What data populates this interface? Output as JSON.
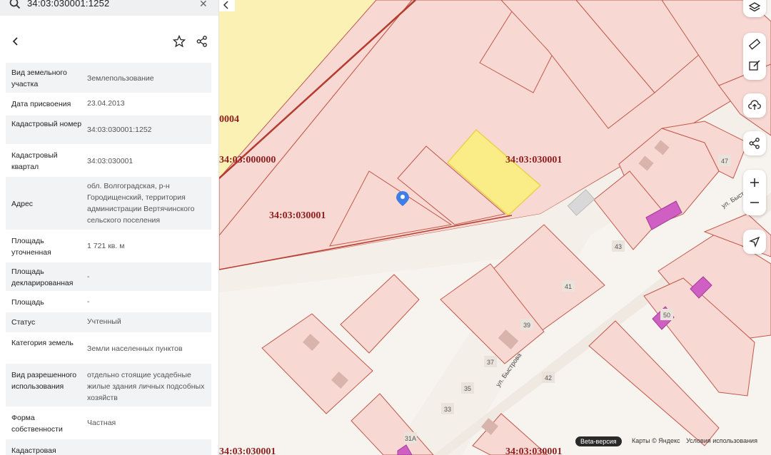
{
  "search": {
    "value": "34:03:030001:1252"
  },
  "icons": {
    "search": "search-icon",
    "clear": "close-icon",
    "back": "chevron-left-icon",
    "favorite": "star-icon",
    "share": "share-icon",
    "layers": "layers-icon",
    "ruler": "ruler-icon",
    "edit": "edit-icon",
    "upload": "upload-icon",
    "map_share": "share-icon",
    "zoom_in": "plus-icon",
    "zoom_out": "minus-icon",
    "locate": "navigation-arrow-icon",
    "collapse": "chevron-left-icon"
  },
  "info": [
    {
      "key": "Вид земельного участка",
      "value": "Землепользование"
    },
    {
      "key": "Дата присвоения",
      "value": "23.04.2013"
    },
    {
      "key": "Кадастровый номер",
      "value": "34:03:030001:1252"
    },
    {
      "key": "Кадастровый квартал",
      "value": "34:03:030001"
    },
    {
      "key": "Адрес",
      "value": "обл. Волгоградская, р-н Городищенский, территория администрации Вертячинского сельского поселения"
    },
    {
      "key": "Площадь уточненная",
      "value": "1 721 кв. м"
    },
    {
      "key": "Площадь декларированная",
      "value": "-"
    },
    {
      "key": "Площадь",
      "value": "-"
    },
    {
      "key": "Статус",
      "value": "Учтенный"
    },
    {
      "key": "Категория земель",
      "value": "Земли населенных пунктов"
    },
    {
      "key": "Вид разрешенного использования",
      "value": "отдельно стоящие усадебные жилые здания личных подсобных хозяйств"
    },
    {
      "key": "Форма собственности",
      "value": "Частная"
    },
    {
      "key": "Кадастровая",
      "value": ""
    }
  ],
  "map": {
    "labels": {
      "q0004": "0004",
      "q000000": "34:03:000000",
      "q030001_a": "34:03:030001",
      "q030001_b": "34:03:030001",
      "q030001_c": "34:03:030001",
      "q030001_d": "34:03:030001"
    },
    "streets": {
      "bystrova_a": "ул. Быстрова",
      "bystrova_b": "ул. Быст"
    },
    "houses": [
      "47",
      "43",
      "41",
      "39",
      "37",
      "35",
      "33",
      "42",
      "50",
      "31А"
    ],
    "colors": {
      "parcel_fill": "#f8d8d3",
      "parcel_stroke": "#c0584a",
      "quarter_line": "#b43b2e",
      "selected_fill": "#faec86",
      "selected_stroke": "#e9d24b",
      "yellow_area": "#fbf1b5",
      "building": "#cf5fc3",
      "pin": "#3f7ee8",
      "label": "#8e1f1f"
    },
    "attribution": {
      "beta": "Beta-версия",
      "maps": "Карты © Яндекс",
      "terms": "Условия использования"
    }
  }
}
